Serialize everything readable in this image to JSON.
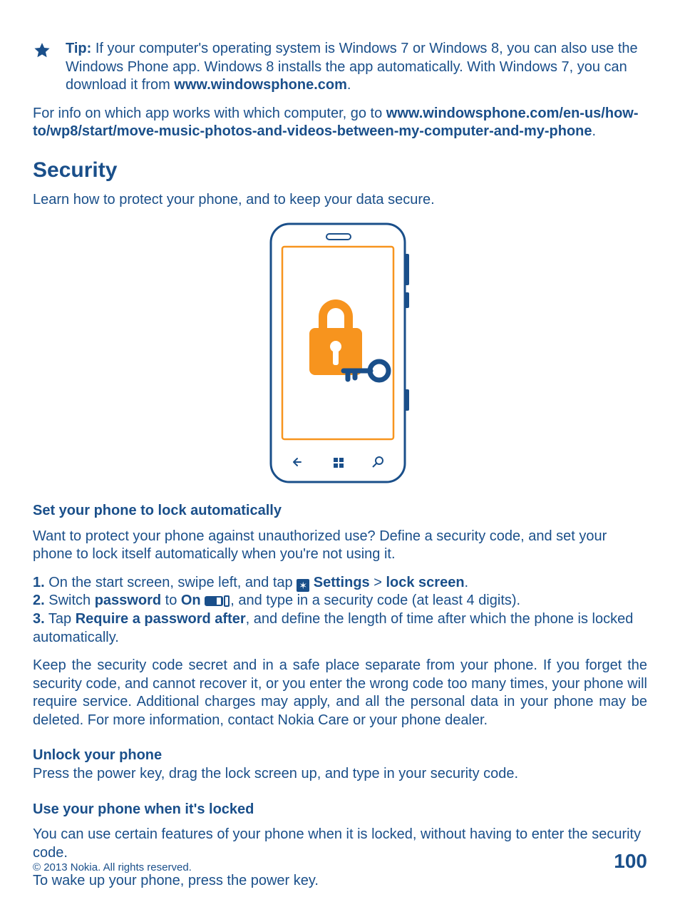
{
  "tip": {
    "label": "Tip:",
    "text_1": " If your computer's operating system is Windows 7 or Windows 8, you can also use the Windows Phone app. Windows 8 installs the app automatically. With Windows 7, you can download it from ",
    "link": "www.windowsphone.com",
    "period": "."
  },
  "intro": {
    "pre": "For info on which app works with which computer, go to ",
    "link": "www.windowsphone.com/en-us/how-to/wp8/start/move-music-photos-and-videos-between-my-computer-and-my-phone",
    "period": "."
  },
  "security": {
    "heading": "Security",
    "lede": "Learn how to protect your phone, and to keep your data secure."
  },
  "set_lock": {
    "heading": "Set your phone to lock automatically",
    "intro": "Want to protect your phone against unauthorized use? Define a security code, and set your phone to lock itself automatically when you're not using it.",
    "s1_num": "1.",
    "s1_a": " On the start screen, swipe left, and tap ",
    "s1_settings": "Settings",
    "s1_gt": " > ",
    "s1_lock": "lock screen",
    "s1_end": ".",
    "s2_num": "2.",
    "s2_a": " Switch ",
    "s2_pw": "password",
    "s2_to": " to ",
    "s2_on": "On",
    "s2_end": ", and type in a security code (at least 4 digits).",
    "s3_num": "3.",
    "s3_a": " Tap ",
    "s3_req": "Require a password after",
    "s3_end": ", and define the length of time after which the phone is locked automatically.",
    "note": "Keep the security code secret and in a safe place separate from your phone. If you forget the security code, and cannot recover it, or you enter the wrong code too many times, your phone will require service. Additional charges may apply, and all the personal data in your phone may be deleted. For more information, contact Nokia Care or your phone dealer."
  },
  "unlock": {
    "heading": "Unlock your phone",
    "text": "Press the power key, drag the lock screen up, and type in your security code."
  },
  "use_locked": {
    "heading": "Use your phone when it's locked",
    "p1": "You can use certain features of your phone when it is locked, without having to enter the security code.",
    "p2": "To wake up your phone, press the power key."
  },
  "footer": {
    "copyright": "© 2013 Nokia. All rights reserved.",
    "page": "100"
  },
  "colors": {
    "blue": "#1a4f8a",
    "orange": "#f7941e"
  }
}
